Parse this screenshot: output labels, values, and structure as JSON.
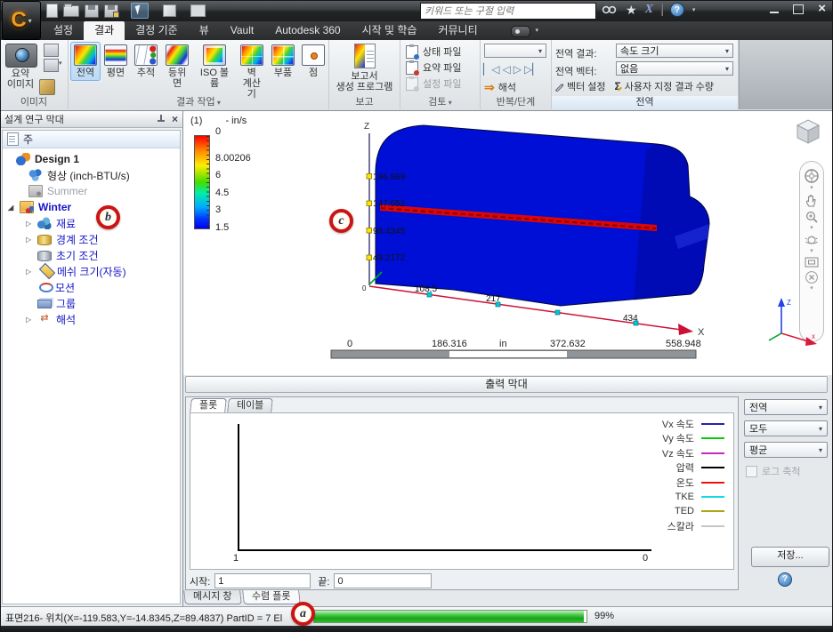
{
  "titlebar": {
    "app_button": "C",
    "search_placeholder": "키워드 또는 구절 입력",
    "qat_icons": [
      "new-file-icon",
      "open-icon",
      "save-icon",
      "save-as-icon",
      "select-cursor-icon",
      "volume-box-icon",
      "table-view-icon"
    ],
    "right_icons": [
      "search-go-icon",
      "favorites-star-icon",
      "exchange-apps-icon",
      "help-icon"
    ],
    "window_buttons": [
      "minimize",
      "maximize",
      "close"
    ]
  },
  "menu": {
    "tabs": [
      {
        "label": "설정",
        "state": ""
      },
      {
        "label": "결과",
        "state": "active"
      },
      {
        "label": "결정 기준",
        "state": ""
      },
      {
        "label": "뷰",
        "state": ""
      },
      {
        "label": "Vault",
        "state": ""
      },
      {
        "label": "Autodesk 360",
        "state": ""
      },
      {
        "label": "시작 및 학습",
        "state": ""
      },
      {
        "label": "커뮤니티",
        "state": ""
      }
    ]
  },
  "ribbon": {
    "image_group": {
      "label": "이미지",
      "summary_label": "요약\n이미지"
    },
    "results_group": {
      "label": "결과 작업",
      "buttons": [
        {
          "label": "전역",
          "icon": "ric-global",
          "state": "active"
        },
        {
          "label": "평면",
          "icon": "ric-planes",
          "state": ""
        },
        {
          "label": "추적",
          "icon": "ric-traces",
          "state": ""
        },
        {
          "label": "등위면",
          "icon": "ric-isosurf",
          "state": ""
        },
        {
          "label": "ISO 볼륨",
          "icon": "ric-isovol",
          "state": ""
        },
        {
          "label": "벽\n계산기",
          "icon": "ric-wallcalc",
          "state": ""
        },
        {
          "label": "부품",
          "icon": "ric-parts",
          "state": ""
        },
        {
          "label": "점",
          "icon": "ric-points",
          "state": ""
        }
      ]
    },
    "report_group": {
      "label": "보고",
      "generator_label": "보고서\n생성 프로그램"
    },
    "review_group": {
      "label": "검토",
      "items": [
        {
          "label": "상태 파일",
          "icon": "file-status-icon",
          "state": ""
        },
        {
          "label": "요약 파일",
          "icon": "file-summary-icon",
          "state": ""
        },
        {
          "label": "설정 파일",
          "icon": "file-settings-icon",
          "state": "disabled"
        }
      ]
    },
    "iter_group": {
      "label": "반복/단계",
      "combo_value": "",
      "playback": [
        {
          "name": "step-first-icon",
          "glyph": "▏◁"
        },
        {
          "name": "step-back-icon",
          "glyph": "◁"
        },
        {
          "name": "step-forward-icon",
          "glyph": "▷"
        },
        {
          "name": "step-last-icon",
          "glyph": "▷▏"
        }
      ],
      "analyze_label": "해석"
    },
    "global_group": {
      "label": "전역",
      "result_label": "전역 결과:",
      "result_value": "속도 크기",
      "vector_label": "전역 벡터:",
      "vector_value": "없음",
      "vector_settings_label": "벡터 설정",
      "custom_qty_label": "사용자 지정 결과 수량"
    }
  },
  "design_bar": {
    "title": "설계 연구 막대",
    "root_item": "주",
    "tree": [
      {
        "label": "Design 1",
        "icon": "tic-design",
        "cls": "lvl0 bold",
        "arrow": ""
      },
      {
        "label": "형상 (inch-BTU/s)",
        "icon": "tic-geometry",
        "cls": "lvl1 plain",
        "arrow": ""
      },
      {
        "label": "Summer",
        "icon": "tic-scenario-gray",
        "cls": "lvl1 gray",
        "arrow": ""
      },
      {
        "label": "Winter",
        "icon": "tic-scenario",
        "cls": "lvl1w blue bold",
        "arrow": "◢"
      },
      {
        "label": "재료",
        "icon": "tic-materials",
        "cls": "lvl2 blue",
        "arrow": "▷"
      },
      {
        "label": "경계 조건",
        "icon": "tic-boundary",
        "cls": "lvl2 blue",
        "arrow": "▷"
      },
      {
        "label": "초기 조건",
        "icon": "tic-initial",
        "cls": "lvl2 blue",
        "arrow": ""
      },
      {
        "label": "메쉬 크기(자동)",
        "icon": "tic-mesh",
        "cls": "lvl2 blue",
        "arrow": "▷"
      },
      {
        "label": "모션",
        "icon": "tic-motion",
        "cls": "lvl2 blue",
        "arrow": ""
      },
      {
        "label": "그룹",
        "icon": "tic-group",
        "cls": "lvl2 blue",
        "arrow": ""
      },
      {
        "label": "해석",
        "icon": "tic-analysis",
        "cls": "lvl2 blue",
        "arrow": "▷"
      }
    ]
  },
  "viewport": {
    "legend": {
      "index": "(1)",
      "unit": "- in/s",
      "ticks": [
        "8.00206",
        "6",
        "4.5",
        "3",
        "1.5",
        "0"
      ]
    },
    "z_axis": {
      "label": "Z",
      "origin": "0",
      "ticks": [
        "196.869",
        "147.652",
        "98.4345",
        "49.2172"
      ]
    },
    "x_axis": {
      "label": "X",
      "ticks": [
        "108.5",
        "217",
        "434"
      ]
    },
    "ruler": {
      "labels": [
        "0",
        "186.316",
        "in",
        "372.632",
        "558.948"
      ]
    },
    "triad_labels": {
      "z": "Z",
      "x": "x"
    },
    "nav_icons": [
      "steering-wheel-icon",
      "pan-hand-icon",
      "zoom-icon",
      "orbit-icon",
      "look-at-icon",
      "close-nav-icon"
    ]
  },
  "output_bar": {
    "title": "출력 막대",
    "tabs": [
      {
        "label": "플롯",
        "state": "active"
      },
      {
        "label": "테이블",
        "state": ""
      }
    ],
    "plot_x_left": "1",
    "plot_x_right": "0",
    "legend": [
      {
        "label": "Vx 속도",
        "color": "#2424ac"
      },
      {
        "label": "Vy 속도",
        "color": "#0cc80c"
      },
      {
        "label": "Vz 속도",
        "color": "#c32cc3"
      },
      {
        "label": "압력",
        "color": "#000000"
      },
      {
        "label": "온도",
        "color": "#e81414"
      },
      {
        "label": "TKE",
        "color": "#14dcdc"
      },
      {
        "label": "TED",
        "color": "#a8a818"
      },
      {
        "label": "스칼라",
        "color": "#c6c6c6"
      }
    ],
    "controls": {
      "combos": [
        "전역",
        "모두",
        "평균"
      ],
      "log_scale_label": "로그 축척",
      "save_label": "저장..."
    },
    "start_label": "시작:",
    "start_value": "1",
    "end_label": "끝:",
    "end_value": "0",
    "bottom_tabs": [
      {
        "label": "메시지 창",
        "state": ""
      },
      {
        "label": "수렴 플롯",
        "state": "active"
      }
    ]
  },
  "status_bar": {
    "message": "표면216- 위치(X=-119.583,Y=-14.8345,Z=89.4837) PartID = 7 El",
    "progress_percent": "99%"
  },
  "annotations": {
    "a": "a",
    "b": "b",
    "c": "c"
  },
  "chart_data": {
    "type": "line",
    "title": "수렴 플롯 (convergence plot, no data drawn)",
    "x_axis_labels": [
      "1",
      "0"
    ],
    "series": [],
    "legend_entries": [
      "Vx 속도",
      "Vy 속도",
      "Vz 속도",
      "압력",
      "온도",
      "TKE",
      "TED",
      "스칼라"
    ],
    "grid": false,
    "legend_position": "right-inside"
  }
}
